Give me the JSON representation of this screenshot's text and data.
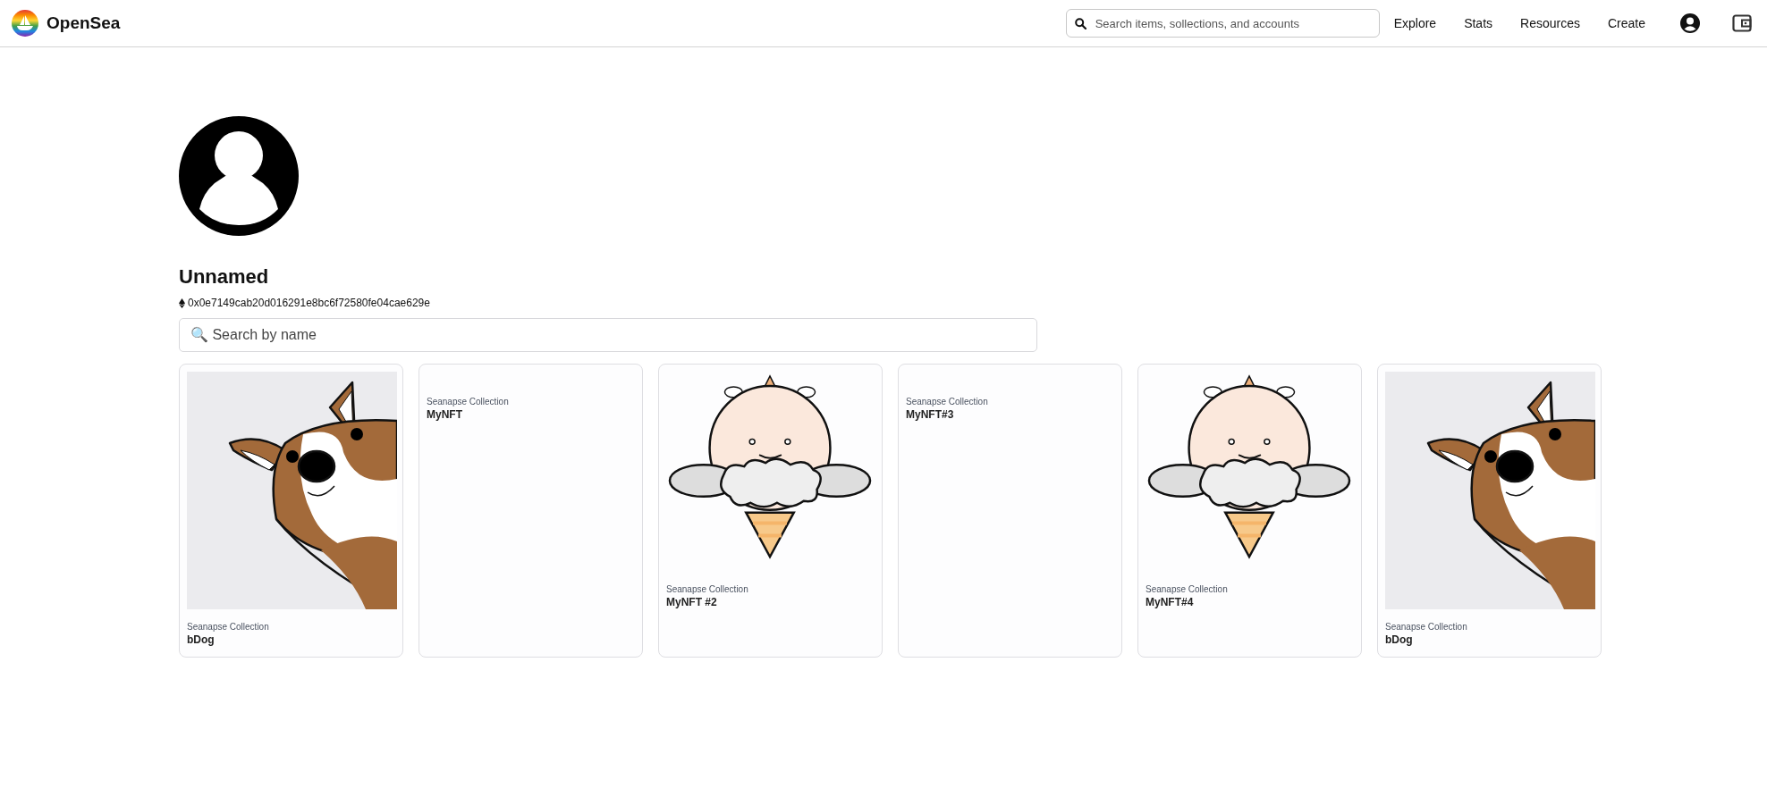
{
  "header": {
    "logo_text": "OpenSea",
    "search": {
      "placeholder": "Search items, sollections, and accounts"
    },
    "nav": [
      "Explore",
      "Stats",
      "Resources",
      "Create"
    ]
  },
  "profile": {
    "name": "Unnamed",
    "address": "0x0e7149cab20d016291e8bc6f72580fe04cae629e"
  },
  "search": {
    "placeholder": "🔍 Search by name"
  },
  "items": [
    {
      "kind": "dog",
      "collection": "Seanapse Collection",
      "name": "bDog"
    },
    {
      "kind": "none",
      "collection": "Seanapse Collection",
      "name": "MyNFT"
    },
    {
      "kind": "bee",
      "collection": "Seanapse Collection",
      "name": "MyNFT #2"
    },
    {
      "kind": "none",
      "collection": "Seanapse Collection",
      "name": "MyNFT#3"
    },
    {
      "kind": "bee",
      "collection": "Seanapse Collection",
      "name": "MyNFT#4"
    },
    {
      "kind": "dog",
      "collection": "Seanapse Collection",
      "name": "bDog"
    }
  ]
}
